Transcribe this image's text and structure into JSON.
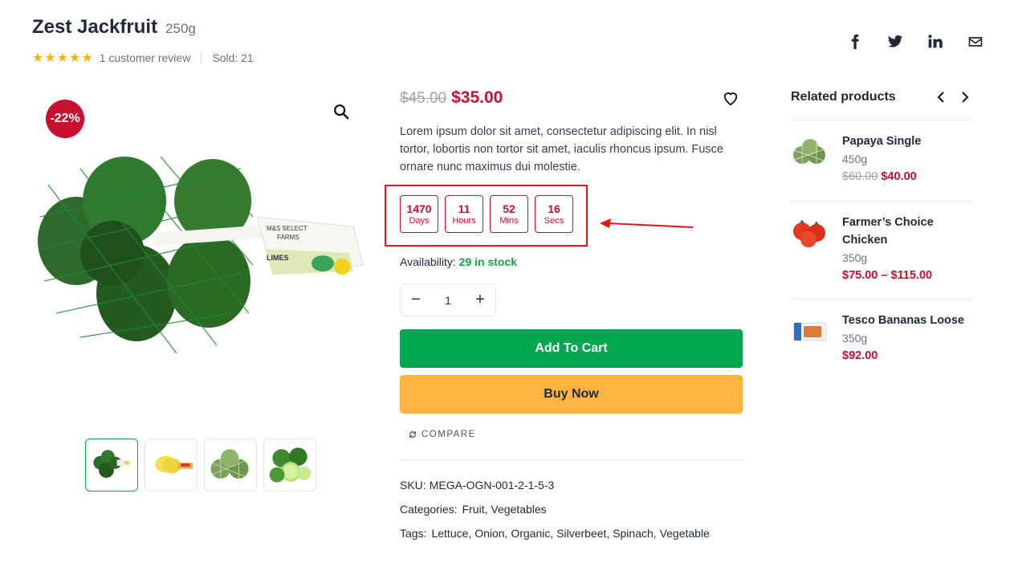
{
  "product": {
    "title": "Zest Jackfruit",
    "weight": "250g",
    "rating_stars": 5,
    "review_text": "1 customer review",
    "sold_text": "Sold: 21",
    "discount_badge": "-22%",
    "old_price": "$45.00",
    "new_price": "$35.00",
    "description": "Lorem ipsum dolor sit amet, consectetur adipiscing elit. In nisl tortor, lobortis non tortor sit amet, iaculis rhoncus ipsum. Fusce ornare nunc maximus dui molestie.",
    "image_label": "M&S SELECT FARMS LIMES",
    "availability_label": "Availability:",
    "availability_value": "29 in stock",
    "quantity": "1",
    "add_to_cart": "Add To Cart",
    "buy_now": "Buy Now",
    "compare_label": "COMPARE",
    "sku_label": "SKU:",
    "sku_value": "MEGA-OGN-001-2-1-5-3",
    "categories_label": "Categories:",
    "categories": [
      "Fruit",
      "Vegetables"
    ],
    "tags_label": "Tags:",
    "tags": [
      "Lettuce",
      "Onion",
      "Organic",
      "Silverbeet",
      "Spinach",
      "Vegetable"
    ]
  },
  "countdown": {
    "days": "1470",
    "days_label": "Days",
    "hours": "11",
    "hours_label": "Hours",
    "mins": "52",
    "mins_label": "Mins",
    "secs": "16",
    "secs_label": "Secs"
  },
  "social_icons": [
    "facebook-icon",
    "twitter-icon",
    "linkedin-icon",
    "mail-icon"
  ],
  "related": {
    "title": "Related products",
    "items": [
      {
        "name": "Papaya Single",
        "weight": "450g",
        "old_price": "$60.00",
        "price": "$40.00"
      },
      {
        "name": "Farmer’s Choice Chicken",
        "weight": "350g",
        "old_price": "",
        "price": "$75.00 – $115.00"
      },
      {
        "name": "Tesco Bananas Loose",
        "weight": "350g",
        "old_price": "",
        "price": "$92.00"
      }
    ]
  },
  "colors": {
    "accent_red": "#c8102e",
    "add_to_cart_green": "#00a650",
    "buy_now_orange": "#ffb340",
    "stock_green": "#16a34a",
    "star_yellow": "#f5b400"
  }
}
